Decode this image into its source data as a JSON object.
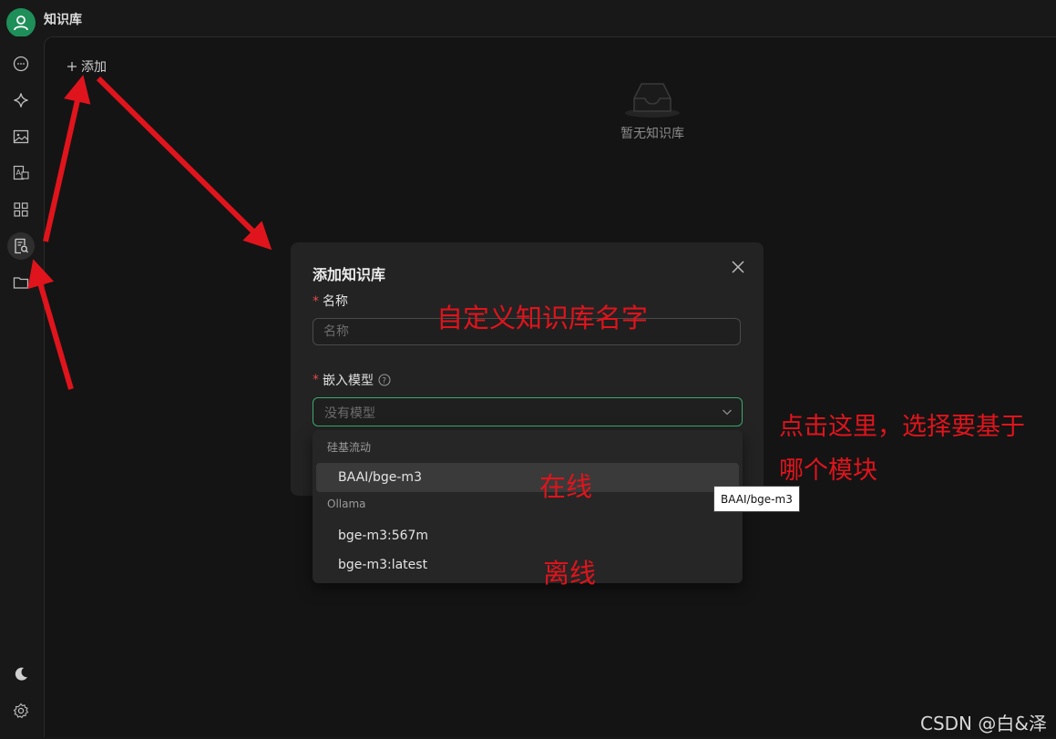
{
  "app": {
    "title": "知识库"
  },
  "sidebar": {
    "items": [
      {
        "icon": "chat-icon"
      },
      {
        "icon": "sparkle-icon"
      },
      {
        "icon": "image-icon"
      },
      {
        "icon": "translate-icon"
      },
      {
        "icon": "apps-grid-icon"
      },
      {
        "icon": "knowledge-search-icon",
        "active": true
      },
      {
        "icon": "folder-icon"
      }
    ],
    "bottom": [
      {
        "icon": "moon-icon"
      },
      {
        "icon": "gear-icon"
      }
    ]
  },
  "panel": {
    "add_label": "添加"
  },
  "main": {
    "empty_text": "暂无知识库"
  },
  "modal": {
    "title": "添加知识库",
    "name_label": "名称",
    "name_placeholder": "名称",
    "model_label": "嵌入模型",
    "model_placeholder": "没有模型"
  },
  "dropdown": {
    "groups": [
      {
        "title": "硅基流动",
        "options": [
          "BAAI/bge-m3"
        ]
      },
      {
        "title": "Ollama",
        "options": [
          "bge-m3:567m",
          "bge-m3:latest"
        ]
      }
    ]
  },
  "tooltip": "BAAI/bge-m3",
  "annotations": {
    "name_note": "自定义知识库名字",
    "click_note_line1": "点击这里，选择要基于",
    "click_note_line2": "哪个模块",
    "online": "在线",
    "offline": "离线"
  },
  "watermark": "CSDN @白&泽",
  "colors": {
    "accent": "#1f8f5a",
    "focus_border": "#3ea874",
    "annotation": "#e0141c"
  }
}
